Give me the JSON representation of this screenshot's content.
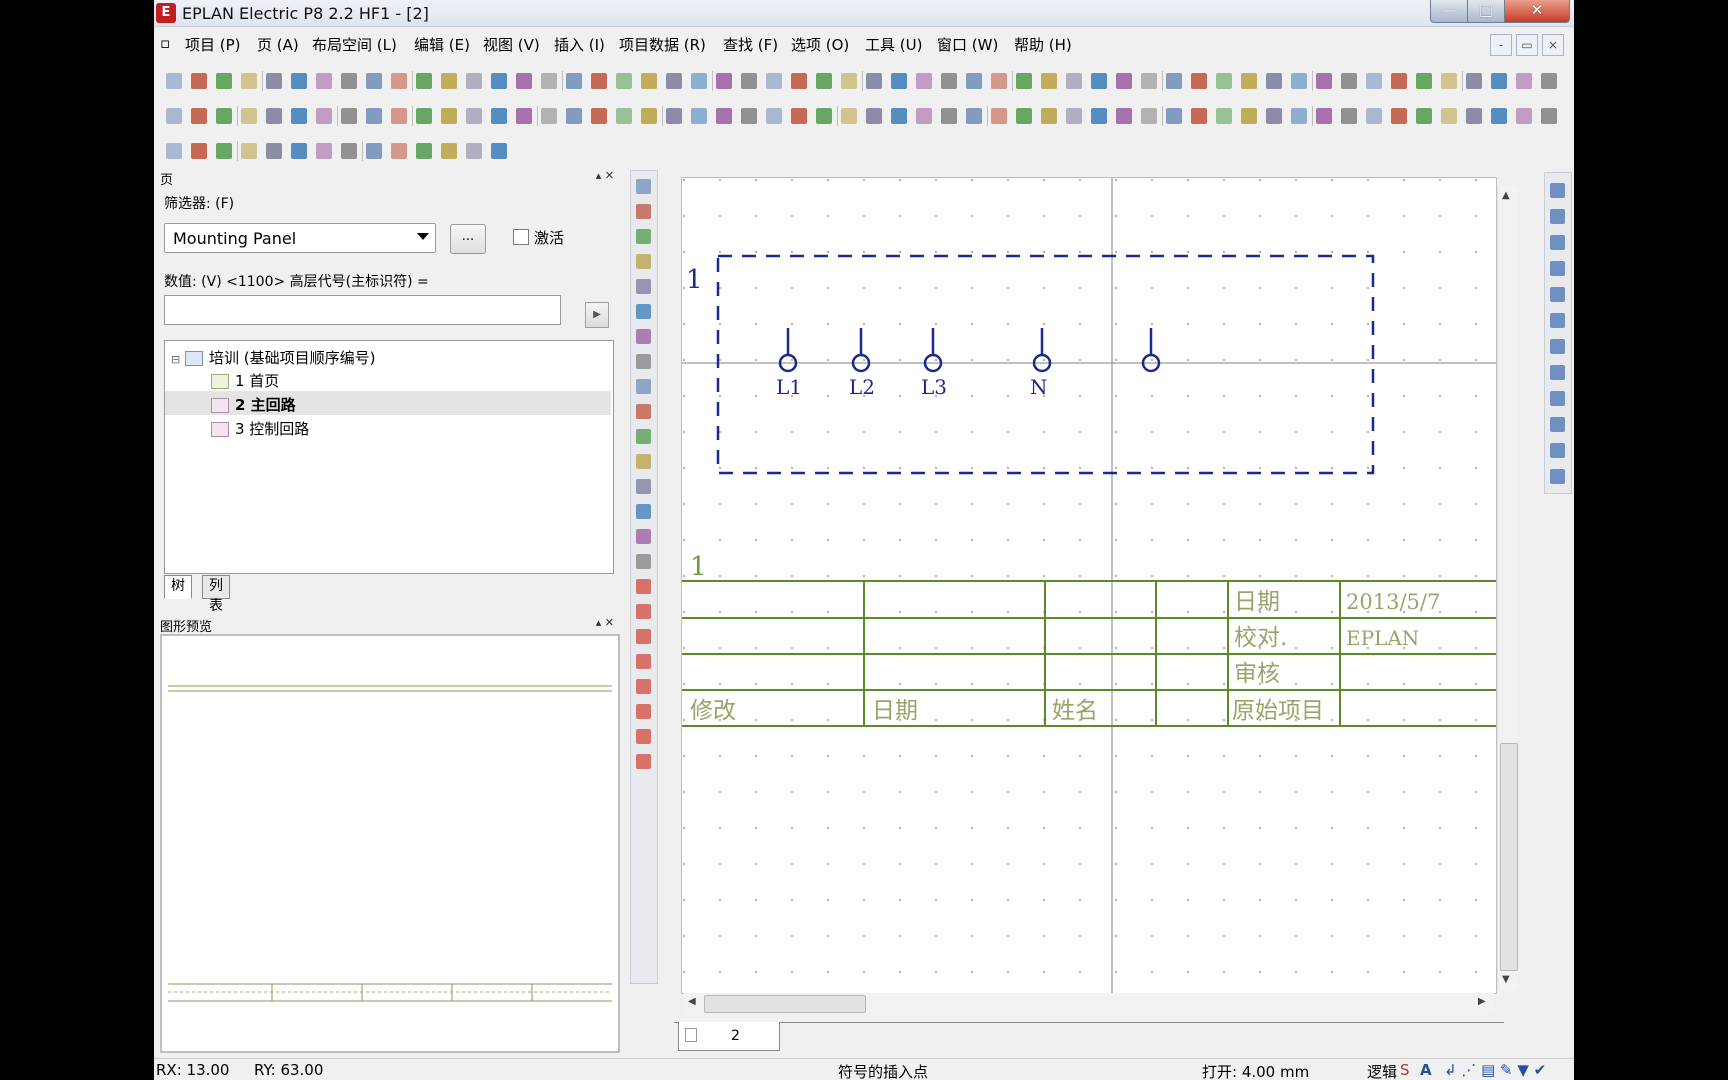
{
  "window": {
    "title": "EPLAN Electric P8 2.2 HF1 - [2]",
    "controls": {
      "minimize": "—",
      "maximize": "□",
      "close": "✕"
    }
  },
  "menu": {
    "items": [
      "项目 (P)",
      "页 (A)",
      "布局空间 (L)",
      "编辑 (E)",
      "视图 (V)",
      "插入 (I)",
      "项目数据 (R)",
      "查找 (F)",
      "选项 (O)",
      "工具 (U)",
      "窗口 (W)",
      "帮助 (H)"
    ],
    "mdi": [
      "-",
      "▭",
      "×"
    ]
  },
  "page_panel": {
    "title": "页",
    "filter_label": "筛选器: (F)",
    "filter_value": "Mounting Panel",
    "browse_label": "...",
    "activate_label": "激活",
    "value_label": "数值: (V) <1100> 高层代号(主标识符) =",
    "value_input": "",
    "tree": {
      "project": "培训 (基础项目顺序编号)",
      "pages": [
        "1 首页",
        "2 主回路",
        "3 控制回路"
      ],
      "selected": 1
    },
    "tabs": [
      "树",
      "列表"
    ]
  },
  "preview_panel": {
    "title": "图形预览"
  },
  "drawing": {
    "corner_marker": "1",
    "terminals": [
      "L1",
      "L2",
      "L3",
      "N"
    ],
    "column_number": "1",
    "title_block": {
      "date_label": "日期",
      "date_value": "2013/5/7",
      "check_label": "校对.",
      "check_value": "EPLAN",
      "review_label": "审核",
      "revise_label": "修改",
      "date2_label": "日期",
      "name_label": "姓名",
      "origin_label": "原始项目"
    },
    "line_color": "#1a2a8c",
    "frame_color": "#5a8a2a"
  },
  "sheet_tab": "2",
  "status_bar": {
    "rx": "RX: 13.00",
    "ry": "RY: 63.00",
    "hint": "符号的插入点",
    "grid": "打开: 4.00 mm",
    "mode": "逻辑"
  }
}
